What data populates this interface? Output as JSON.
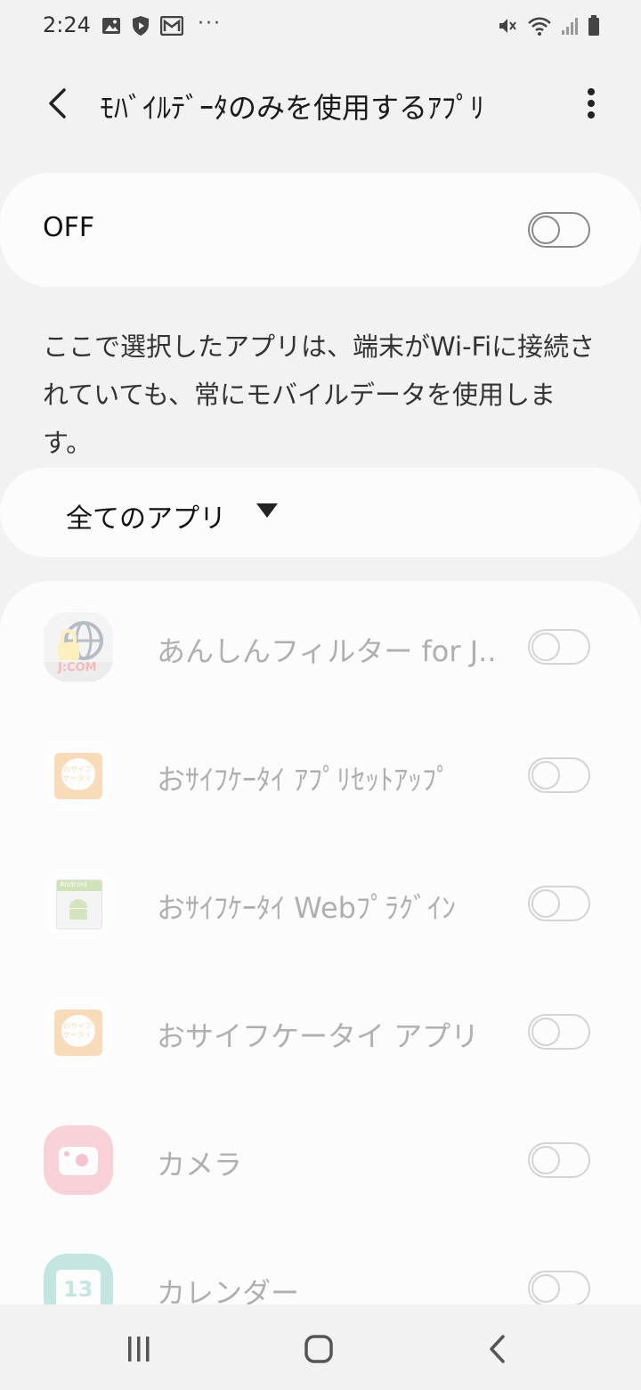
{
  "status_bar": {
    "time": "2:24",
    "more": "···"
  },
  "header": {
    "title": "ﾓﾊﾞｲﾙﾃﾞｰﾀのみを使用するｱﾌﾟﾘ"
  },
  "master": {
    "label": "OFF",
    "state": "off"
  },
  "description": "ここで選択したアプリは、端末がWi-Fiに接続されていても、常にモバイルデータを使用します。",
  "filter": {
    "label": "全てのアプリ"
  },
  "apps": [
    {
      "label": "あんしんフィルター for J..",
      "icon": "jcom-globe-lock-icon",
      "icon_text": "J:COM",
      "state": "off"
    },
    {
      "label": "おｻｲﾌｹｰﾀｲ ｱﾌﾟﾘｾｯﾄｱｯﾌﾟ",
      "icon": "osaifu-keitai-icon",
      "icon_text": "おサイフケータイ",
      "state": "off"
    },
    {
      "label": "おｻｲﾌｹｰﾀｲ Webﾌﾟﾗｸﾞｲﾝ",
      "icon": "android-plugin-icon",
      "icon_text": "Android",
      "state": "off"
    },
    {
      "label": "おサイフケータイ アプリ",
      "icon": "osaifu-keitai-icon",
      "icon_text": "おサイフケータイ",
      "state": "off"
    },
    {
      "label": "カメラ",
      "icon": "camera-icon",
      "state": "off"
    },
    {
      "label": "カレンダー",
      "icon": "calendar-icon",
      "icon_text": "13",
      "state": "off"
    }
  ],
  "colors": {
    "background": "#f2f2f2",
    "card": "#fcfcfc",
    "camera_pink": "#f4849a",
    "calendar_teal": "#5fbfae",
    "osaifu_orange": "#f3a140"
  }
}
